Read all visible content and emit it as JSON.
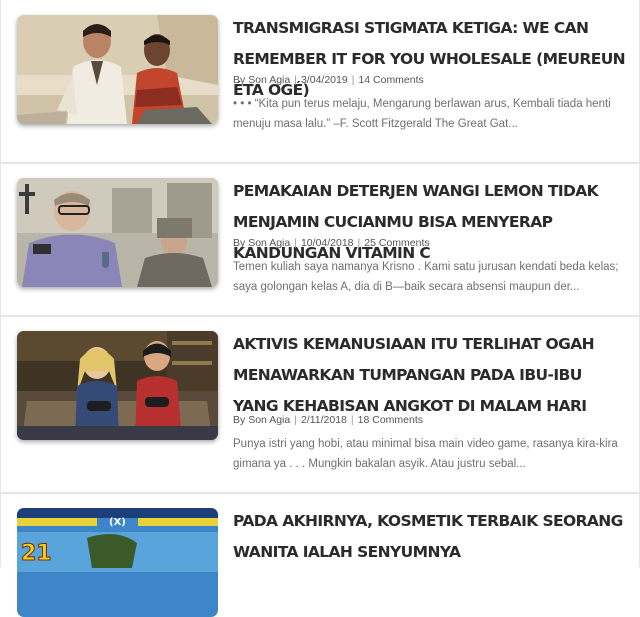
{
  "posts": [
    {
      "title": "TRANSMIGRASI STIGMATA KETIGA: WE CAN REMEMBER IT FOR YOU WHOLESALE (MEUREUN ÉTA OGÉ)",
      "author_prefix": "By",
      "author": "Son Agia",
      "date": "3/04/2019",
      "comments": "14 Comments",
      "excerpt": "• • • “Kita pun terus melaju, Mengarung berlawan arus, Kembali tiada henti menuju masa lalu.” –F. Scott Fitzgerald The Great Gat..."
    },
    {
      "title": "PEMAKAIAN DETERJEN WANGI LEMON TIDAK MENJAMIN CUCIANMU BISA MENYERAP KANDUNGAN VITAMIN C",
      "author_prefix": "By",
      "author": "Son Agia",
      "date": "10/04/2018",
      "comments": "25 Comments",
      "excerpt": "Temen kuliah saya namanya  Krisno . Kami satu jurusan kendati beda kelas; saya golongan kelas A, dia di B—baik secara absensi maupun der..."
    },
    {
      "title": "AKTIVIS KEMANUSIAAN ITU TERLIHAT OGAH MENAWARKAN TUMPANGAN PADA IBU-IBU YANG KEHABISAN ANGKOT DI MALAM HARI",
      "author_prefix": "By",
      "author": "Son Agia",
      "date": "2/11/2018",
      "comments": "18 Comments",
      "excerpt": "Punya istri yang hobi, atau minimal bisa main video game, rasanya kira-kira gimana ya . . . Mungkin bakalan asyik. Atau justru sebal..."
    },
    {
      "title": "PADA AKHIRNYA, KOSMETIK TERBAIK SEORANG WANITA IALAH SENYUMNYA",
      "thumb_text_big": "21",
      "thumb_text_small": "(X)"
    }
  ]
}
